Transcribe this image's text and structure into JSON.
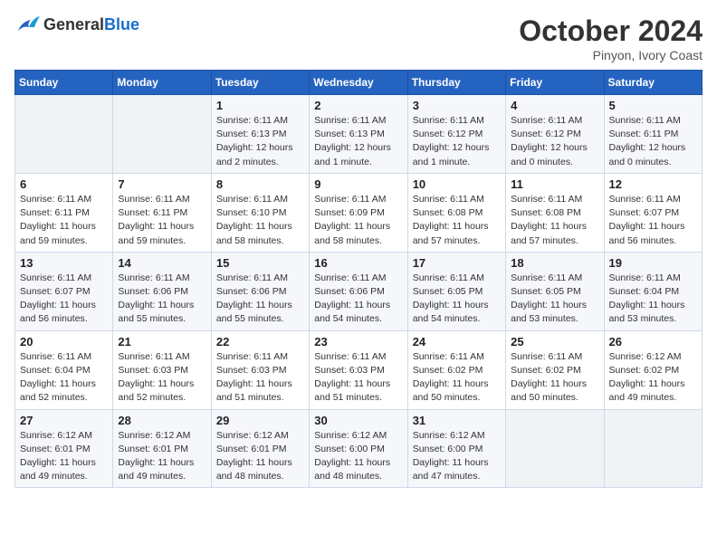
{
  "header": {
    "logo_general": "General",
    "logo_blue": "Blue",
    "month": "October 2024",
    "location": "Pinyon, Ivory Coast"
  },
  "weekdays": [
    "Sunday",
    "Monday",
    "Tuesday",
    "Wednesday",
    "Thursday",
    "Friday",
    "Saturday"
  ],
  "weeks": [
    [
      {
        "day": "",
        "info": ""
      },
      {
        "day": "",
        "info": ""
      },
      {
        "day": "1",
        "info": "Sunrise: 6:11 AM\nSunset: 6:13 PM\nDaylight: 12 hours\nand 2 minutes."
      },
      {
        "day": "2",
        "info": "Sunrise: 6:11 AM\nSunset: 6:13 PM\nDaylight: 12 hours\nand 1 minute."
      },
      {
        "day": "3",
        "info": "Sunrise: 6:11 AM\nSunset: 6:12 PM\nDaylight: 12 hours\nand 1 minute."
      },
      {
        "day": "4",
        "info": "Sunrise: 6:11 AM\nSunset: 6:12 PM\nDaylight: 12 hours\nand 0 minutes."
      },
      {
        "day": "5",
        "info": "Sunrise: 6:11 AM\nSunset: 6:11 PM\nDaylight: 12 hours\nand 0 minutes."
      }
    ],
    [
      {
        "day": "6",
        "info": "Sunrise: 6:11 AM\nSunset: 6:11 PM\nDaylight: 11 hours\nand 59 minutes."
      },
      {
        "day": "7",
        "info": "Sunrise: 6:11 AM\nSunset: 6:11 PM\nDaylight: 11 hours\nand 59 minutes."
      },
      {
        "day": "8",
        "info": "Sunrise: 6:11 AM\nSunset: 6:10 PM\nDaylight: 11 hours\nand 58 minutes."
      },
      {
        "day": "9",
        "info": "Sunrise: 6:11 AM\nSunset: 6:09 PM\nDaylight: 11 hours\nand 58 minutes."
      },
      {
        "day": "10",
        "info": "Sunrise: 6:11 AM\nSunset: 6:08 PM\nDaylight: 11 hours\nand 57 minutes."
      },
      {
        "day": "11",
        "info": "Sunrise: 6:11 AM\nSunset: 6:08 PM\nDaylight: 11 hours\nand 57 minutes."
      },
      {
        "day": "12",
        "info": "Sunrise: 6:11 AM\nSunset: 6:07 PM\nDaylight: 11 hours\nand 56 minutes."
      }
    ],
    [
      {
        "day": "13",
        "info": "Sunrise: 6:11 AM\nSunset: 6:07 PM\nDaylight: 11 hours\nand 56 minutes."
      },
      {
        "day": "14",
        "info": "Sunrise: 6:11 AM\nSunset: 6:06 PM\nDaylight: 11 hours\nand 55 minutes."
      },
      {
        "day": "15",
        "info": "Sunrise: 6:11 AM\nSunset: 6:06 PM\nDaylight: 11 hours\nand 55 minutes."
      },
      {
        "day": "16",
        "info": "Sunrise: 6:11 AM\nSunset: 6:06 PM\nDaylight: 11 hours\nand 54 minutes."
      },
      {
        "day": "17",
        "info": "Sunrise: 6:11 AM\nSunset: 6:05 PM\nDaylight: 11 hours\nand 54 minutes."
      },
      {
        "day": "18",
        "info": "Sunrise: 6:11 AM\nSunset: 6:05 PM\nDaylight: 11 hours\nand 53 minutes."
      },
      {
        "day": "19",
        "info": "Sunrise: 6:11 AM\nSunset: 6:04 PM\nDaylight: 11 hours\nand 53 minutes."
      }
    ],
    [
      {
        "day": "20",
        "info": "Sunrise: 6:11 AM\nSunset: 6:04 PM\nDaylight: 11 hours\nand 52 minutes."
      },
      {
        "day": "21",
        "info": "Sunrise: 6:11 AM\nSunset: 6:03 PM\nDaylight: 11 hours\nand 52 minutes."
      },
      {
        "day": "22",
        "info": "Sunrise: 6:11 AM\nSunset: 6:03 PM\nDaylight: 11 hours\nand 51 minutes."
      },
      {
        "day": "23",
        "info": "Sunrise: 6:11 AM\nSunset: 6:03 PM\nDaylight: 11 hours\nand 51 minutes."
      },
      {
        "day": "24",
        "info": "Sunrise: 6:11 AM\nSunset: 6:02 PM\nDaylight: 11 hours\nand 50 minutes."
      },
      {
        "day": "25",
        "info": "Sunrise: 6:11 AM\nSunset: 6:02 PM\nDaylight: 11 hours\nand 50 minutes."
      },
      {
        "day": "26",
        "info": "Sunrise: 6:12 AM\nSunset: 6:02 PM\nDaylight: 11 hours\nand 49 minutes."
      }
    ],
    [
      {
        "day": "27",
        "info": "Sunrise: 6:12 AM\nSunset: 6:01 PM\nDaylight: 11 hours\nand 49 minutes."
      },
      {
        "day": "28",
        "info": "Sunrise: 6:12 AM\nSunset: 6:01 PM\nDaylight: 11 hours\nand 49 minutes."
      },
      {
        "day": "29",
        "info": "Sunrise: 6:12 AM\nSunset: 6:01 PM\nDaylight: 11 hours\nand 48 minutes."
      },
      {
        "day": "30",
        "info": "Sunrise: 6:12 AM\nSunset: 6:00 PM\nDaylight: 11 hours\nand 48 minutes."
      },
      {
        "day": "31",
        "info": "Sunrise: 6:12 AM\nSunset: 6:00 PM\nDaylight: 11 hours\nand 47 minutes."
      },
      {
        "day": "",
        "info": ""
      },
      {
        "day": "",
        "info": ""
      }
    ]
  ]
}
